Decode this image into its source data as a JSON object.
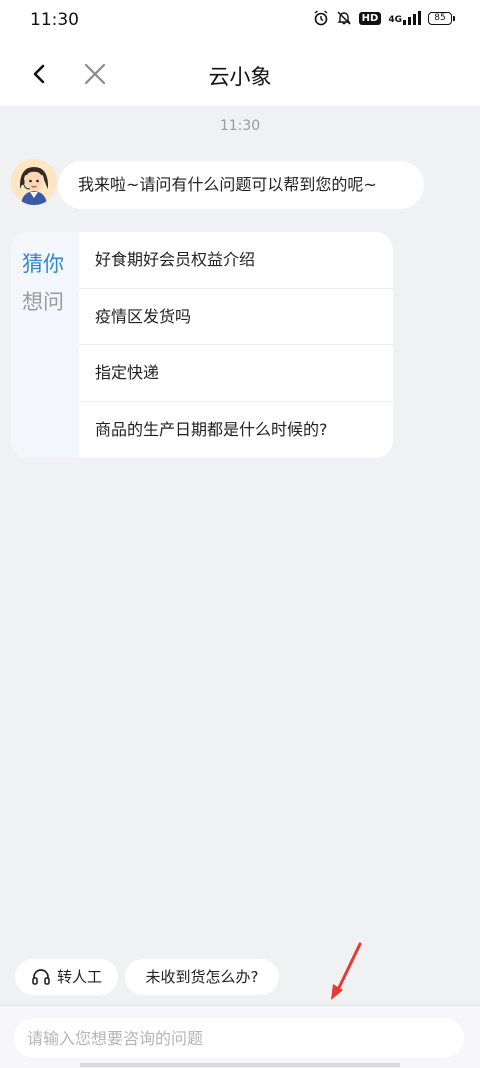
{
  "status_bar": {
    "time": "11:30",
    "icons": [
      "alarm-icon",
      "mute-icon",
      "hd-icon",
      "4g-signal-icon",
      "battery-icon"
    ],
    "hd": "HD",
    "network": "4G",
    "battery": "85"
  },
  "nav": {
    "title": "云小象",
    "back_icon": "back-arrow-icon",
    "close_icon": "close-icon"
  },
  "chat": {
    "timestamp": "11:30",
    "greeting": "我来啦~请问有什么问题可以帮到您的呢~"
  },
  "suggestions": {
    "header_line1": "猜你",
    "header_line2": "想问",
    "items": [
      "好食期好会员权益介绍",
      "疫情区发货吗",
      "指定快递",
      "商品的生产日期都是什么时候的?"
    ]
  },
  "quick_actions": {
    "human_label": "转人工",
    "faq_label": "未收到货怎么办?"
  },
  "input": {
    "placeholder": "请输入您想要咨询的问题"
  },
  "colors": {
    "accent": "#2f88d6",
    "background": "#f0f1f3",
    "annotation_arrow": "#e53935"
  }
}
